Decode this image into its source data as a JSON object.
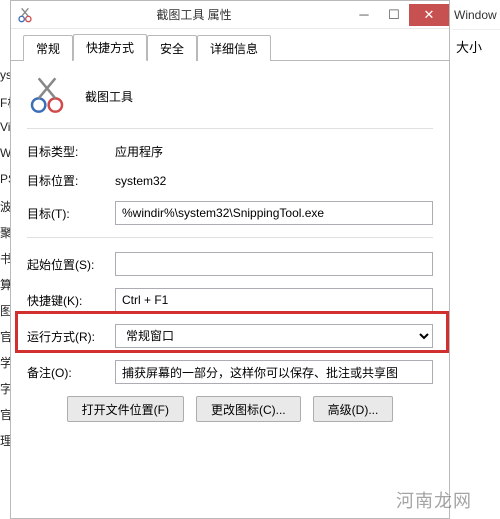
{
  "leftStrip": [
    "yst",
    "F板",
    "Vin",
    "Win",
    "PS",
    "波",
    "聚",
    "书",
    "算",
    "图",
    "官",
    "学",
    "字",
    "官",
    "理"
  ],
  "rightCol": {
    "hdrWin": "Window",
    "hdrSize": "大小"
  },
  "title": "截图工具 属性",
  "tabs": {
    "general": "常规",
    "shortcut": "快捷方式",
    "security": "安全",
    "details": "详细信息"
  },
  "app": {
    "name": "截图工具"
  },
  "rows": {
    "targetType": {
      "label": "目标类型:",
      "value": "应用程序"
    },
    "targetLoc": {
      "label": "目标位置:",
      "value": "system32"
    },
    "target": {
      "label": "目标(T):",
      "value": "%windir%\\system32\\SnippingTool.exe"
    },
    "startIn": {
      "label": "起始位置(S):",
      "value": ""
    },
    "shortcutKey": {
      "label": "快捷键(K):",
      "value": "Ctrl + F1"
    },
    "runMode": {
      "label": "运行方式(R):",
      "value": "常规窗口"
    },
    "comment": {
      "label": "备注(O):",
      "value": "捕获屏幕的一部分，这样你可以保存、批注或共享图"
    }
  },
  "buttons": {
    "openLoc": "打开文件位置(F)",
    "changeIcon": "更改图标(C)...",
    "advanced": "高级(D)..."
  },
  "watermark": "河南龙网"
}
